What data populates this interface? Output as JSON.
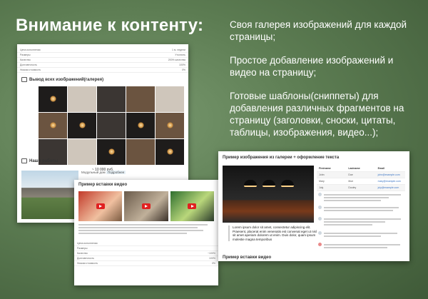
{
  "headline": "Внимание к контенту:",
  "bullets": [
    "Своя галерея изображений для каждой страницы;",
    "Простое добавление изображений и видео на страницу;",
    "Готовые шаблоны(сниппеты) для добавления различных фрагментов на страницу (заголовки, сноски, цитаты, таблицы, изображения, видео...);"
  ],
  "gallery_card": {
    "spec_rows": [
      {
        "label": "Цена исполнения",
        "value": "1 м. недели"
      },
      {
        "label": "Размеры",
        "value": "Уточнить"
      },
      {
        "label": "Качество",
        "value": "200% качества"
      },
      {
        "label": "Долговечность",
        "value": "100%"
      },
      {
        "label": "Низкая стоимость",
        "value": "0%"
      }
    ],
    "gallery_title": "Вывод всех изображений(галерея)",
    "price": "~ 10 000 руб.",
    "works_title": "Наши работы",
    "modular_label": "Модульный дом",
    "modular_badge": "Подробнее"
  },
  "video_card": {
    "title": "Пример вставки видео",
    "spec_rows": [
      {
        "label": "Цена исполнения",
        "value": ""
      },
      {
        "label": "Размеры",
        "value": ""
      },
      {
        "label": "Качество",
        "value": "~100%"
      },
      {
        "label": "Долговечность",
        "value": "100%"
      },
      {
        "label": "Низкая стоимость",
        "value": "0%"
      }
    ]
  },
  "text_card": {
    "title": "Пример изображения из галереи + оформление текста",
    "table_headers": [
      "Firstname",
      "Lastname",
      "Email"
    ],
    "table_rows": [
      [
        "John",
        "Doe",
        "john@example.com"
      ],
      [
        "Mary",
        "Moe",
        "mary@example.com"
      ],
      [
        "July",
        "Dooley",
        "july@example.com"
      ]
    ],
    "lorem": "Lorem ipsum dolor sit amet, consectetur adipiscing elit. Praesent, placerat enim venenatis est convenat eget ut nisl sit amet aperiam dolorem ut enim. Duis dolor, quam ipsum molestie magna temporibus",
    "bottom_heading": "Пример вставки видео"
  },
  "colors": {
    "background": "#5c7c52",
    "accent_link": "#3a74c4",
    "youtube_red": "#e02020"
  }
}
